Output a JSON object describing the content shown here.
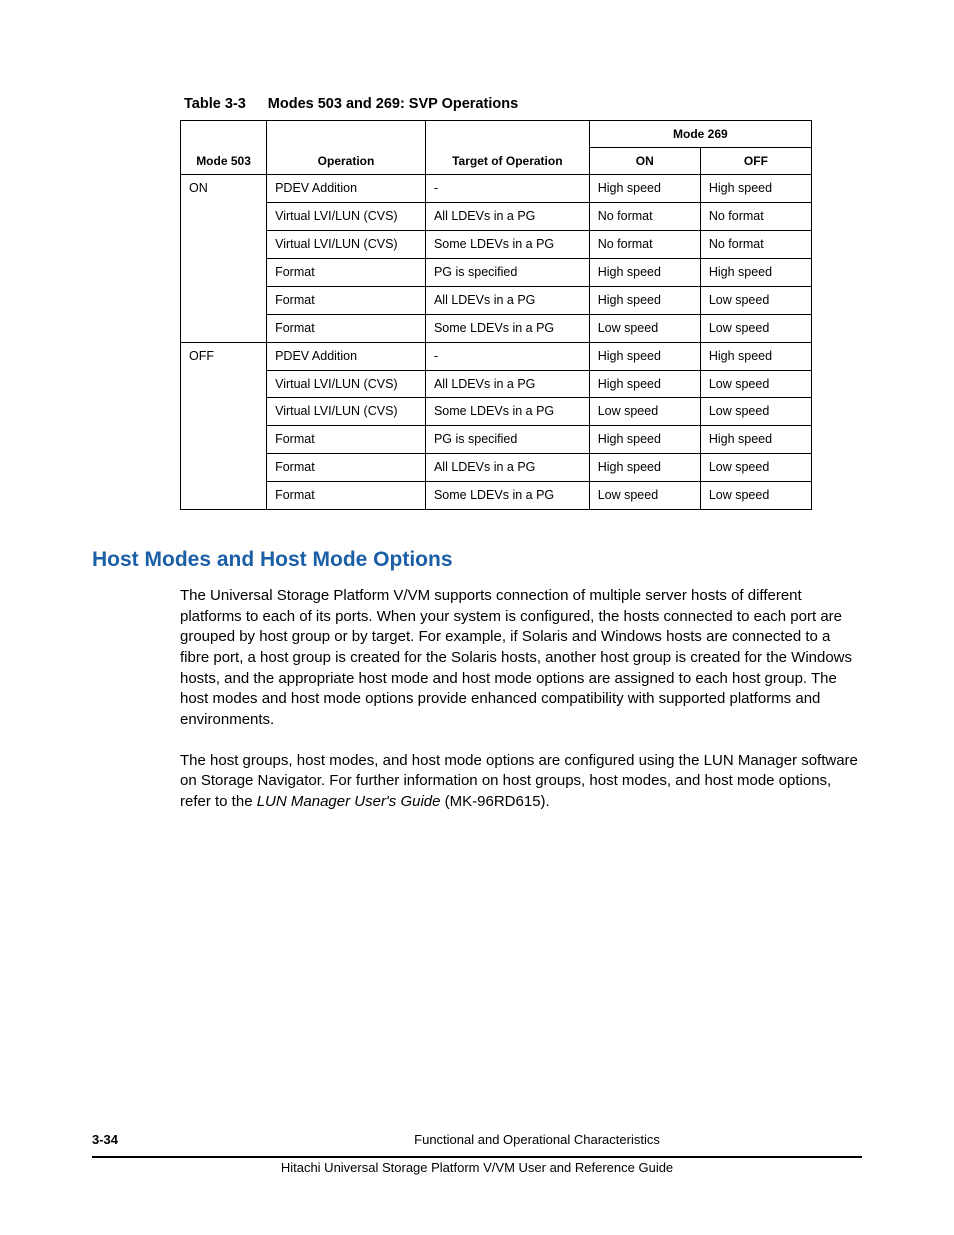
{
  "table": {
    "caption_num": "Table 3-3",
    "caption_title": "Modes 503 and 269: SVP Operations",
    "headers": {
      "c1": "Mode 503",
      "c2": "Operation",
      "c3": "Target of Operation",
      "c4_group": "Mode 269",
      "c4_on": "ON",
      "c4_off": "OFF"
    },
    "group_1_mode": "ON",
    "group_2_mode": "OFF",
    "rows_g1": [
      {
        "op": "PDEV Addition",
        "target": "-",
        "on": "High speed",
        "off": "High speed"
      },
      {
        "op": "Virtual LVI/LUN (CVS)",
        "target": "All LDEVs in a PG",
        "on": "No format",
        "off": "No format"
      },
      {
        "op": "Virtual LVI/LUN (CVS)",
        "target": "Some LDEVs in a PG",
        "on": "No format",
        "off": "No format"
      },
      {
        "op": "Format",
        "target": "PG is specified",
        "on": "High speed",
        "off": "High speed"
      },
      {
        "op": "Format",
        "target": "All LDEVs in a PG",
        "on": "High speed",
        "off": "Low speed"
      },
      {
        "op": "Format",
        "target": "Some LDEVs in a PG",
        "on": "Low speed",
        "off": "Low speed"
      }
    ],
    "rows_g2": [
      {
        "op": "PDEV Addition",
        "target": "-",
        "on": "High speed",
        "off": "High speed"
      },
      {
        "op": "Virtual LVI/LUN (CVS)",
        "target": "All LDEVs in a PG",
        "on": "High speed",
        "off": "Low speed"
      },
      {
        "op": "Virtual LVI/LUN (CVS)",
        "target": "Some LDEVs in a PG",
        "on": "Low speed",
        "off": "Low speed"
      },
      {
        "op": "Format",
        "target": "PG is specified",
        "on": "High speed",
        "off": "High speed"
      },
      {
        "op": "Format",
        "target": "All LDEVs in a PG",
        "on": "High speed",
        "off": "Low speed"
      },
      {
        "op": "Format",
        "target": "Some LDEVs in a PG",
        "on": "Low speed",
        "off": "Low speed"
      }
    ]
  },
  "section": {
    "heading": "Host Modes and Host Mode Options",
    "para1": "The Universal Storage Platform V/VM supports connection of multiple server hosts of different platforms to each of its ports. When your system is configured, the hosts connected to each port are grouped by host group or by target. For example, if Solaris and Windows hosts are connected to a fibre port, a host group is created for the Solaris hosts, another host group is created for the Windows hosts, and the appropriate host mode and host mode options are assigned to each host group. The host modes and host mode options provide enhanced compatibility with supported platforms and environments.",
    "para2_a": "The host groups, host modes, and host mode options are configured using the LUN Manager software on Storage Navigator. For further information on host groups, host modes, and host mode options, refer to the ",
    "para2_i": "LUN Manager User's Guide",
    "para2_b": " (MK-96RD615)."
  },
  "footer": {
    "page": "3-34",
    "title1": "Functional and Operational Characteristics",
    "title2": "Hitachi Universal Storage Platform V/VM User and Reference Guide"
  }
}
